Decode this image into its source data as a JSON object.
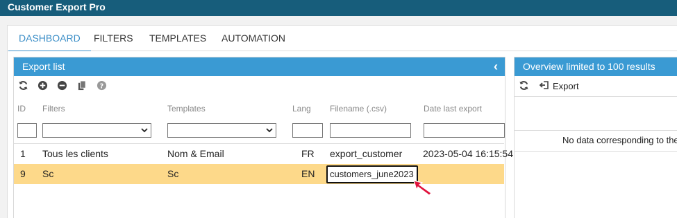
{
  "app": {
    "title": "Customer Export Pro"
  },
  "tabs": [
    {
      "label": "DASHBOARD",
      "active": true
    },
    {
      "label": "FILTERS",
      "active": false
    },
    {
      "label": "TEMPLATES",
      "active": false
    },
    {
      "label": "AUTOMATION",
      "active": false
    }
  ],
  "export_list": {
    "title": "Export list",
    "toolbar_icons": [
      "refresh-icon",
      "add-icon",
      "remove-icon",
      "duplicate-icon",
      "help-icon"
    ],
    "columns": [
      "ID",
      "Filters",
      "Templates",
      "Lang",
      "Filename (.csv)",
      "Date last export"
    ],
    "rows": [
      {
        "id": "1",
        "filter": "Tous les clients",
        "template": "Nom & Email",
        "lang": "FR",
        "filename": "export_customer",
        "date": "2023-05-04 16:15:54"
      },
      {
        "id": "9",
        "filter": "Sc",
        "template": "Sc",
        "lang": "EN",
        "filename": "customers_june2023",
        "date": ""
      }
    ]
  },
  "overview": {
    "title": "Overview limited to 100 results",
    "export_label": "Export",
    "empty_text": "No data corresponding to the"
  },
  "colors": {
    "header": "#175d7b",
    "panel_header": "#3a9ad3",
    "selected_row": "#fdd98a",
    "active_tab": "#3b8ec7",
    "cursor": "#e0113b"
  }
}
